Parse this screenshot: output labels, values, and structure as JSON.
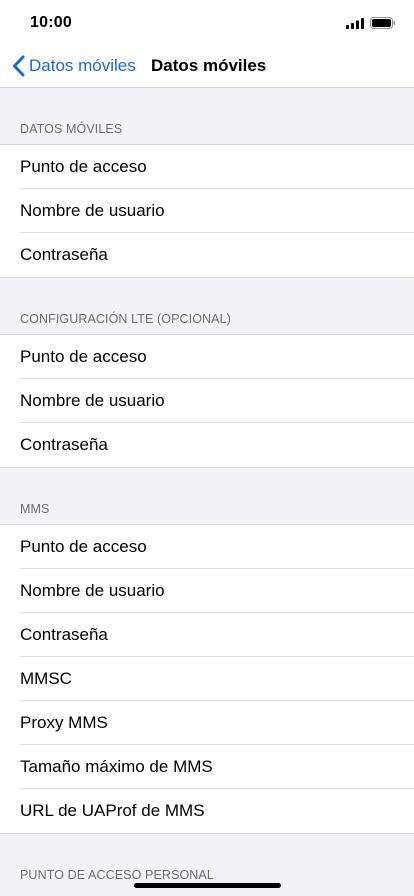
{
  "status_bar": {
    "time": "10:00"
  },
  "nav": {
    "back_label": "Datos móviles",
    "title": "Datos móviles"
  },
  "sections": [
    {
      "header": "DATOS MÓVILES",
      "rows": [
        "Punto de acceso",
        "Nombre de usuario",
        "Contraseña"
      ]
    },
    {
      "header": "CONFIGURACIÓN LTE (OPCIONAL)",
      "rows": [
        "Punto de acceso",
        "Nombre de usuario",
        "Contraseña"
      ]
    },
    {
      "header": "MMS",
      "rows": [
        "Punto de acceso",
        "Nombre de usuario",
        "Contraseña",
        "MMSC",
        "Proxy MMS",
        "Tamaño máximo de MMS",
        "URL de UAProf de MMS"
      ]
    },
    {
      "header": "PUNTO DE ACCESO PERSONAL",
      "rows": []
    }
  ],
  "colors": {
    "accent": "#1a66d6",
    "background": "#f2f2f7",
    "section_header": "#6d6d72"
  }
}
